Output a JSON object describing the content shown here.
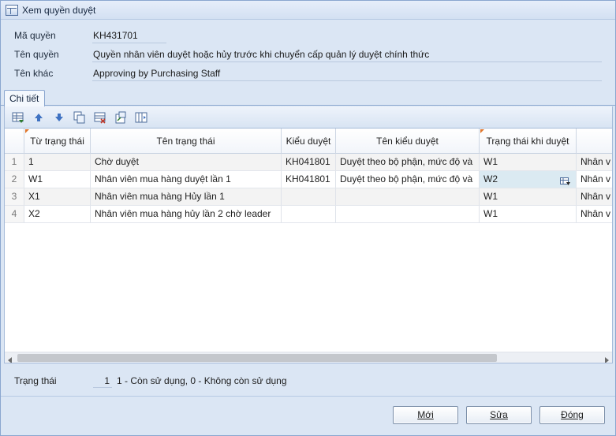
{
  "window": {
    "title": "Xem quyền duyệt"
  },
  "fields": {
    "ma_quyen": {
      "label": "Mã quyền",
      "value": "KH431701"
    },
    "ten_quyen": {
      "label": "Tên quyền",
      "value": "Quyền nhân viên duyệt hoặc hủy trước khi chuyển cấp quản lý duyệt chính thức"
    },
    "ten_khac": {
      "label": "Tên khác",
      "value": "Approving by Purchasing Staff"
    }
  },
  "tabs": [
    {
      "label": "Chi tiết"
    }
  ],
  "toolbar": {
    "icons": [
      "insert-row-icon",
      "move-up-icon",
      "move-down-icon",
      "copy-icon",
      "delete-row-icon",
      "export-icon",
      "columns-icon"
    ]
  },
  "grid": {
    "columns": [
      "",
      "Từ trạng thái",
      "Tên trạng thái",
      "Kiểu duyệt",
      "Tên kiểu duyệt",
      "Trạng thái khi duyệt",
      ""
    ],
    "rows": [
      {
        "no": "1",
        "tu": "1",
        "ten": "Chờ duyệt",
        "kieu": "KH041801",
        "tenkieu": "Duyệt theo bộ phận, mức độ và",
        "khiduyet": "W1",
        "next": "Nhân v"
      },
      {
        "no": "2",
        "tu": "W1",
        "ten": "Nhân viên mua hàng duyệt lần 1",
        "kieu": "KH041801",
        "tenkieu": "Duyệt theo bộ phận, mức độ và",
        "khiduyet": "W2",
        "next": "Nhân v"
      },
      {
        "no": "3",
        "tu": "X1",
        "ten": "Nhân viên mua hàng Hủy lần 1",
        "kieu": "",
        "tenkieu": "",
        "khiduyet": "W1",
        "next": "Nhân v"
      },
      {
        "no": "4",
        "tu": "X2",
        "ten": "Nhân viên mua hàng hủy lần 2 chờ leader",
        "kieu": "",
        "tenkieu": "",
        "khiduyet": "W1",
        "next": "Nhân v"
      }
    ],
    "selected_row": 1,
    "selected_column": "khiduyet"
  },
  "status": {
    "label": "Trạng thái",
    "value": "1",
    "hint": "1 - Còn sử dụng, 0 - Không còn sử dụng"
  },
  "buttons": {
    "new": {
      "label": "Mới"
    },
    "edit": {
      "label": "Sửa"
    },
    "close": {
      "label": "Đóng"
    }
  },
  "colors": {
    "window_bg": "#dbe6f4",
    "border": "#8aa6cf",
    "selected_cell": "#dbeaf2",
    "alt_row": "#f3f3f3",
    "header_marker": "#e0752b"
  }
}
